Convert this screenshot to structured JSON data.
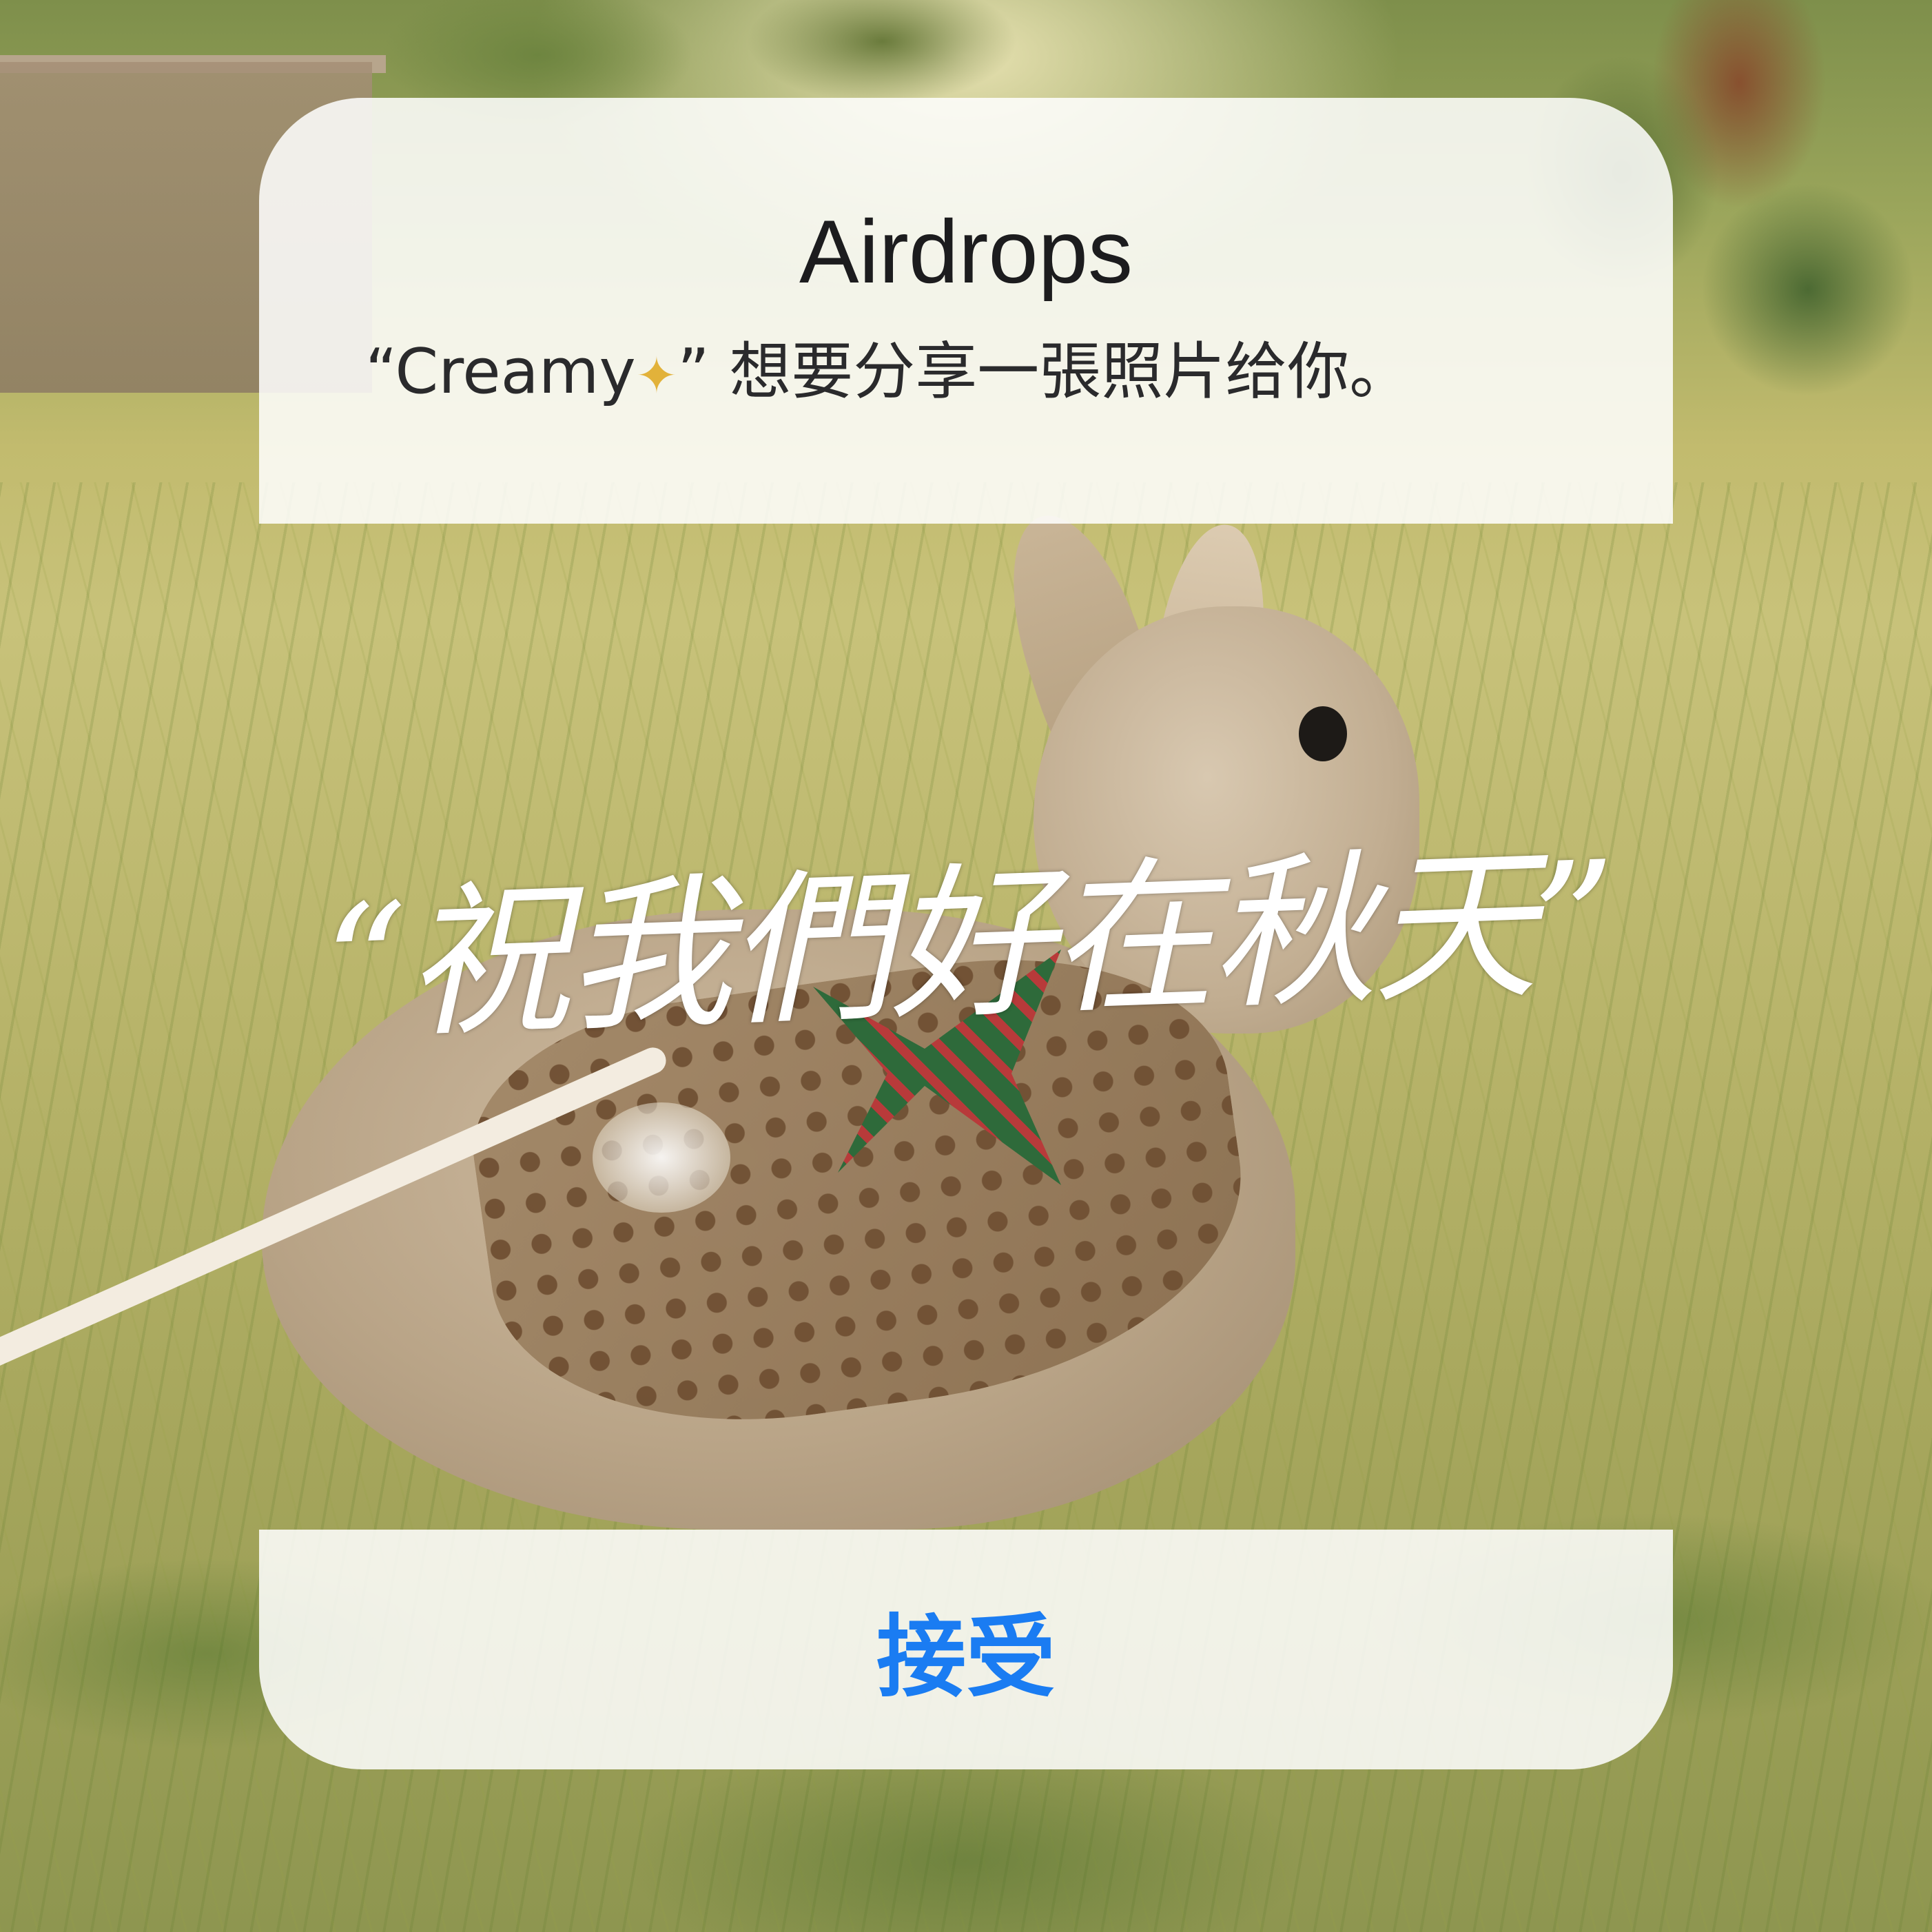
{
  "dialog": {
    "title": "Airdrops",
    "message_prefix": "“Creamy",
    "message_icon": "dizzy-star-icon",
    "message_suffix": "” 想要分享一張照片给你。",
    "accept_label": "接受",
    "accent_color": "#1a7cf2"
  },
  "photo": {
    "overlay_text": "“祝我們好在秋天”"
  }
}
